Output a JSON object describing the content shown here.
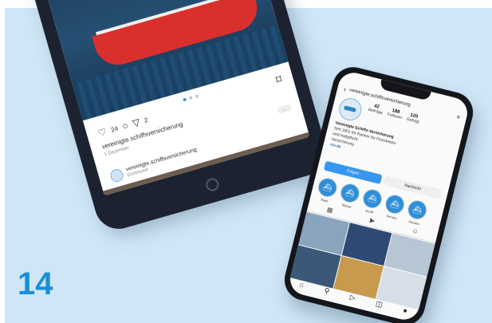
{
  "page_number": "14",
  "tablet": {
    "like_count": "24",
    "comment_count": "",
    "share_count": "2",
    "handle": "vereinigte.schiffsversicherung",
    "date": "1 Dezember",
    "more": "...",
    "next_post": {
      "handle": "vereinigte.schiffsversicherung",
      "location": "Dortmund"
    },
    "icons": [
      "heart-icon",
      "comment-icon",
      "share-icon",
      "bookmark-icon"
    ]
  },
  "phone": {
    "header": {
      "back": "‹",
      "username": "vereinigte.schiffsversicherung",
      "menu": "≡"
    },
    "stats": [
      {
        "value": "42",
        "label": "Beiträge"
      },
      {
        "value": "188",
        "label": "Follower"
      },
      {
        "value": "120",
        "label": "Gefolgt"
      }
    ],
    "bio": {
      "name": "Vereinigte Schiffs-Versicherung",
      "line1": "Seit 1901 Ihr Partner für Flusskasko",
      "line2": "und Haftpflicht",
      "line3": "Versicherung",
      "link": "vsv.de"
    },
    "follow_label": "Folgen",
    "message_label": "Nachricht",
    "highlights": [
      "Team",
      "Messe",
      "Schiff",
      "Service",
      "Kunden"
    ],
    "nav_icons": [
      "home-icon",
      "search-icon",
      "reels-icon",
      "shop-icon",
      "profile-icon"
    ]
  }
}
